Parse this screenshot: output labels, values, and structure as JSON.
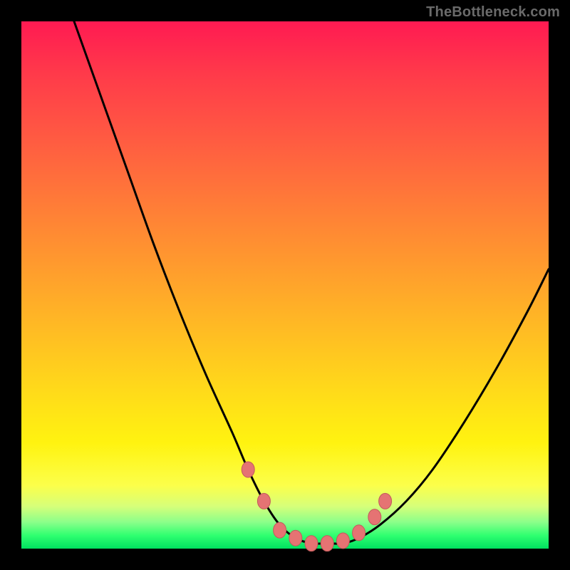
{
  "brand": "TheBottleneck.com",
  "colors": {
    "frame": "#000000",
    "curve_stroke": "#000000",
    "marker_fill": "#e57373",
    "marker_stroke": "#c25b5b",
    "brand_text": "#6a6a6a"
  },
  "chart_data": {
    "type": "line",
    "title": "",
    "xlabel": "",
    "ylabel": "",
    "xlim": [
      0,
      100
    ],
    "ylim": [
      0,
      100
    ],
    "grid": false,
    "legend": false,
    "series": [
      {
        "name": "bottleneck-curve",
        "x": [
          10,
          15,
          20,
          25,
          30,
          35,
          40,
          43,
          46,
          49,
          52,
          55,
          58,
          61,
          64,
          68,
          73,
          78,
          84,
          90,
          96,
          100
        ],
        "values": [
          100,
          86,
          72,
          58,
          45,
          33,
          22,
          15,
          9,
          4.5,
          2,
          1,
          1,
          1,
          2,
          4.5,
          9,
          15,
          24,
          34,
          45,
          53
        ]
      }
    ],
    "markers": {
      "name": "bottom-cluster",
      "x": [
        43,
        46,
        49,
        52,
        55,
        58,
        61,
        64,
        67,
        69
      ],
      "values": [
        15,
        9,
        3.5,
        2,
        1,
        1,
        1.5,
        3,
        6,
        9
      ]
    }
  }
}
